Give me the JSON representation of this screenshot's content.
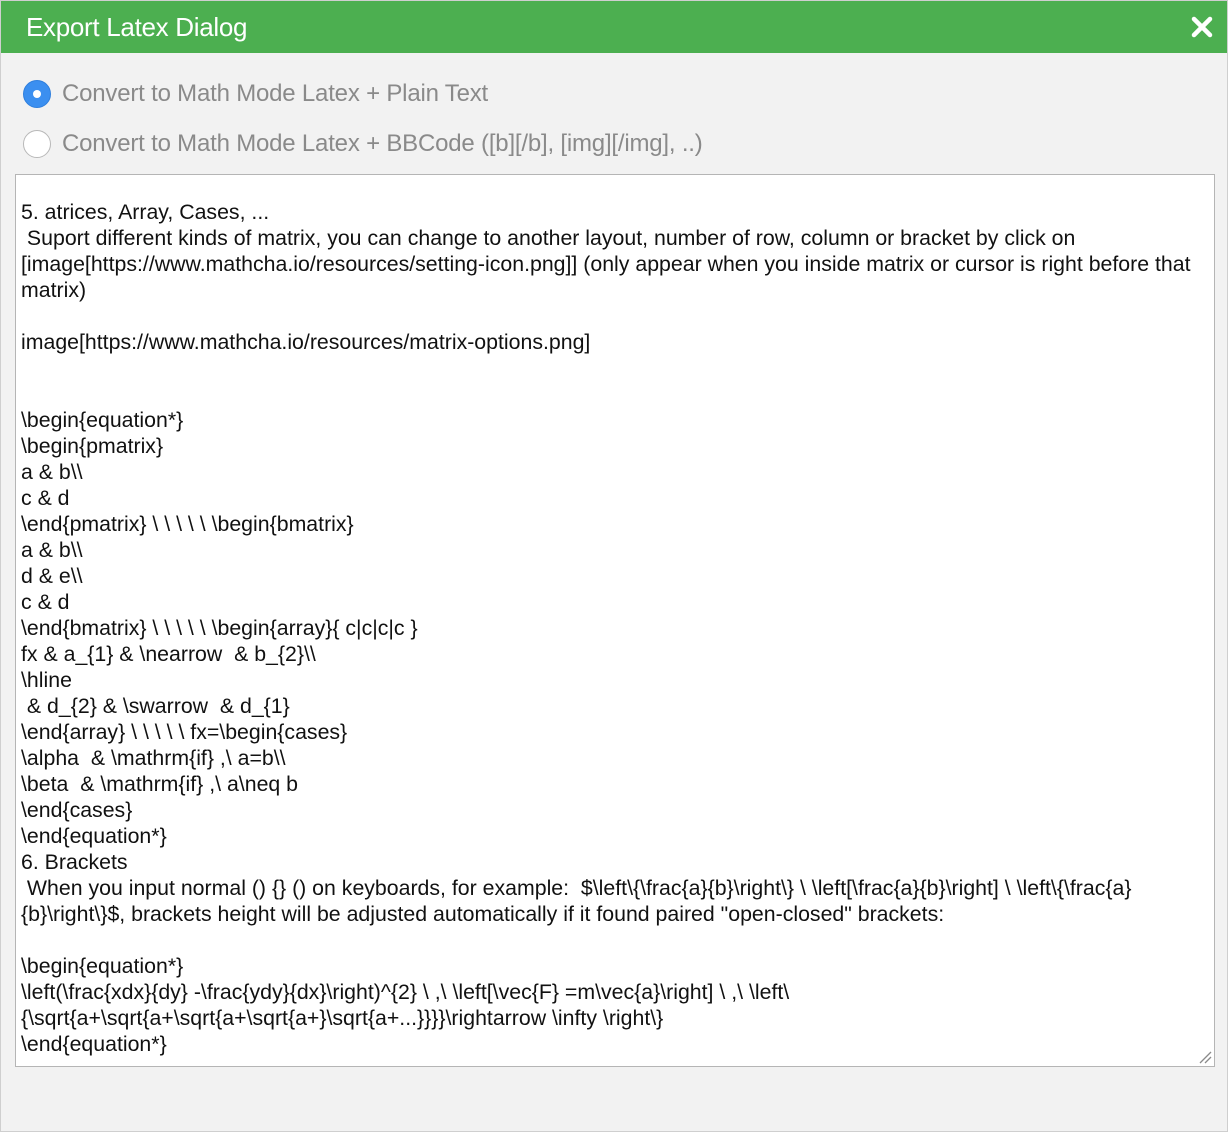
{
  "dialog": {
    "title": "Export Latex Dialog",
    "close_icon": "close-icon",
    "accent_color": "#4caf50"
  },
  "options": [
    {
      "label": "Convert to Math Mode Latex + Plain Text",
      "checked": true
    },
    {
      "label": "Convert to Math Mode Latex + BBCode ([b][/b], [img][/img], ..)",
      "checked": false
    }
  ],
  "output": {
    "value": "5. atrices, Array, Cases, ...\n Suport different kinds of matrix, you can change to another layout, number of row, column or bracket by click on [image[https://www.mathcha.io/resources/setting-icon.png]] (only appear when you inside matrix or cursor is right before that matrix)\n\nimage[https://www.mathcha.io/resources/matrix-options.png]\n\n\n\\begin{equation*}\n\\begin{pmatrix}\na & b\\\\\nc & d\n\\end{pmatrix} \\ \\ \\ \\ \\ \\begin{bmatrix}\na & b\\\\\nd & e\\\\\nc & d\n\\end{bmatrix} \\ \\ \\ \\ \\ \\begin{array}{ c|c|c|c }\nfx & a_{1} & \\nearrow  & b_{2}\\\\\n\\hline\n & d_{2} & \\swarrow  & d_{1}\n\\end{array} \\ \\ \\ \\ \\ fx=\\begin{cases}\n\\alpha  & \\mathrm{if} ,\\ a=b\\\\\n\\beta  & \\mathrm{if} ,\\ a\\neq b\n\\end{cases}\n\\end{equation*}\n6. Brackets\n When you input normal () {} () on keyboards, for example:  $\\left\\{\\frac{a}{b}\\right\\} \\ \\left[\\frac{a}{b}\\right] \\ \\left\\{\\frac{a}{b}\\right\\}$, brackets height will be adjusted automatically if it found paired \"open-closed\" brackets:\n\n\\begin{equation*}\n\\left(\\frac{xdx}{dy} -\\frac{ydy}{dx}\\right)^{2} \\ ,\\ \\left[\\vec{F} =m\\vec{a}\\right] \\ ,\\ \\left\\{\\sqrt{a+\\sqrt{a+\\sqrt{a+\\sqrt{a+}\\sqrt{a+...}}}}\\rightarrow \\infty \\right\\}\n\\end{equation*}"
  }
}
